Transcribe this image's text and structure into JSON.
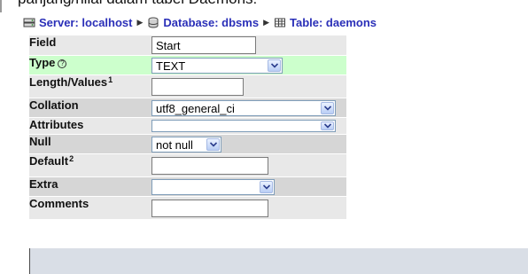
{
  "caption": "panjang/nilai dalam tabel Daemons:",
  "breadcrumb": [
    {
      "icon": "server-icon",
      "label": "Server: localhost"
    },
    {
      "icon": "database-icon",
      "label": "Database: dbsms"
    },
    {
      "icon": "table-icon",
      "label": "Table: daemons"
    }
  ],
  "fields": {
    "field": {
      "label": "Field",
      "value": "Start"
    },
    "type": {
      "label": "Type",
      "value": "TEXT"
    },
    "length": {
      "label": "Length/Values",
      "footnote": "1",
      "value": ""
    },
    "collation": {
      "label": "Collation",
      "value": "utf8_general_ci"
    },
    "attributes": {
      "label": "Attributes",
      "value": ""
    },
    "null": {
      "label": "Null",
      "value": "not null"
    },
    "default": {
      "label": "Default",
      "footnote": "2",
      "value": ""
    },
    "extra": {
      "label": "Extra",
      "value": ""
    },
    "comments": {
      "label": "Comments",
      "value": ""
    }
  },
  "colors": {
    "link": "#2a2fb8",
    "row_highlight": "#ccffcc",
    "row_light": "#e8e8e8",
    "row_dark": "#d6d6d6",
    "bottom_bar": "#d9dee6"
  }
}
